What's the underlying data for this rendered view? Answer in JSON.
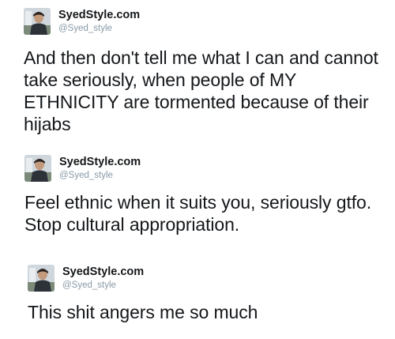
{
  "tweets": [
    {
      "display_name": "SyedStyle.com",
      "handle": "@Syed_style",
      "avatar_icon": "profile-photo-icon",
      "text": "And then don't tell me what I can and cannot take seriously, when people of MY ETHNICITY are tormented because of their hijabs"
    },
    {
      "display_name": "SyedStyle.com",
      "handle": "@Syed_style",
      "avatar_icon": "profile-photo-icon",
      "text": "Feel ethnic when it suits you, seriously gtfo. Stop cultural appropriation."
    },
    {
      "display_name": "SyedStyle.com",
      "handle": "@Syed_style",
      "avatar_icon": "profile-photo-icon",
      "text": "This shit angers me so much"
    }
  ]
}
